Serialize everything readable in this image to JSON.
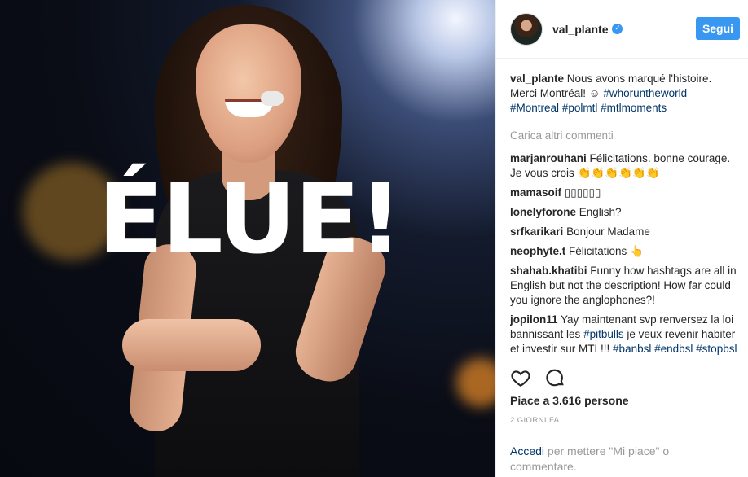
{
  "photo": {
    "headline": "ÉLUE!"
  },
  "header": {
    "username": "val_plante",
    "verified_icon": "verified-badge-icon",
    "follow_label": "Segui"
  },
  "caption": {
    "username": "val_plante",
    "text": "Nous avons marqué l'histoire. Merci Montréal! ☺",
    "hashtags": [
      "#whorunthe world",
      "#Montreal",
      "#polmtl",
      "#mtlmoments"
    ]
  },
  "load_more": "Carica altri commenti",
  "comments": [
    {
      "user": "marjanrouhani",
      "text": "Félicitations. bonne courage. Je vous crois 👏👏👏👏👏👏"
    },
    {
      "user": "mamasoif",
      "text": "▯▯▯▯▯▯"
    },
    {
      "user": "lonelyforone",
      "text": "English?"
    },
    {
      "user": "srfkarikari",
      "text": "Bonjour Madame"
    },
    {
      "user": "neophyte.t",
      "text": "Félicitations 👆"
    },
    {
      "user": "shahab.khatibi",
      "text": "Funny how hashtags are all in English but not the description! How far could you ignore the anglophones?!"
    },
    {
      "user": "jopilon11",
      "text": "Yay maintenant svp renversez la loi bannissant les",
      "tag1": "#pitbulls",
      "text2": "je veux revenir habiter et investir sur MTL!!!",
      "tag2": "#banbsl",
      "tag3": "#endbsl",
      "tag4": "#stopbsl"
    }
  ],
  "actions": {
    "like_icon": "heart-icon",
    "comment_icon": "comment-bubble-icon"
  },
  "likes": "Piace a 3.616 persone",
  "timestamp": "2 GIORNI FA",
  "login": {
    "link": "Accedi",
    "rest": "per mettere \"Mi piace\" o commentare."
  }
}
